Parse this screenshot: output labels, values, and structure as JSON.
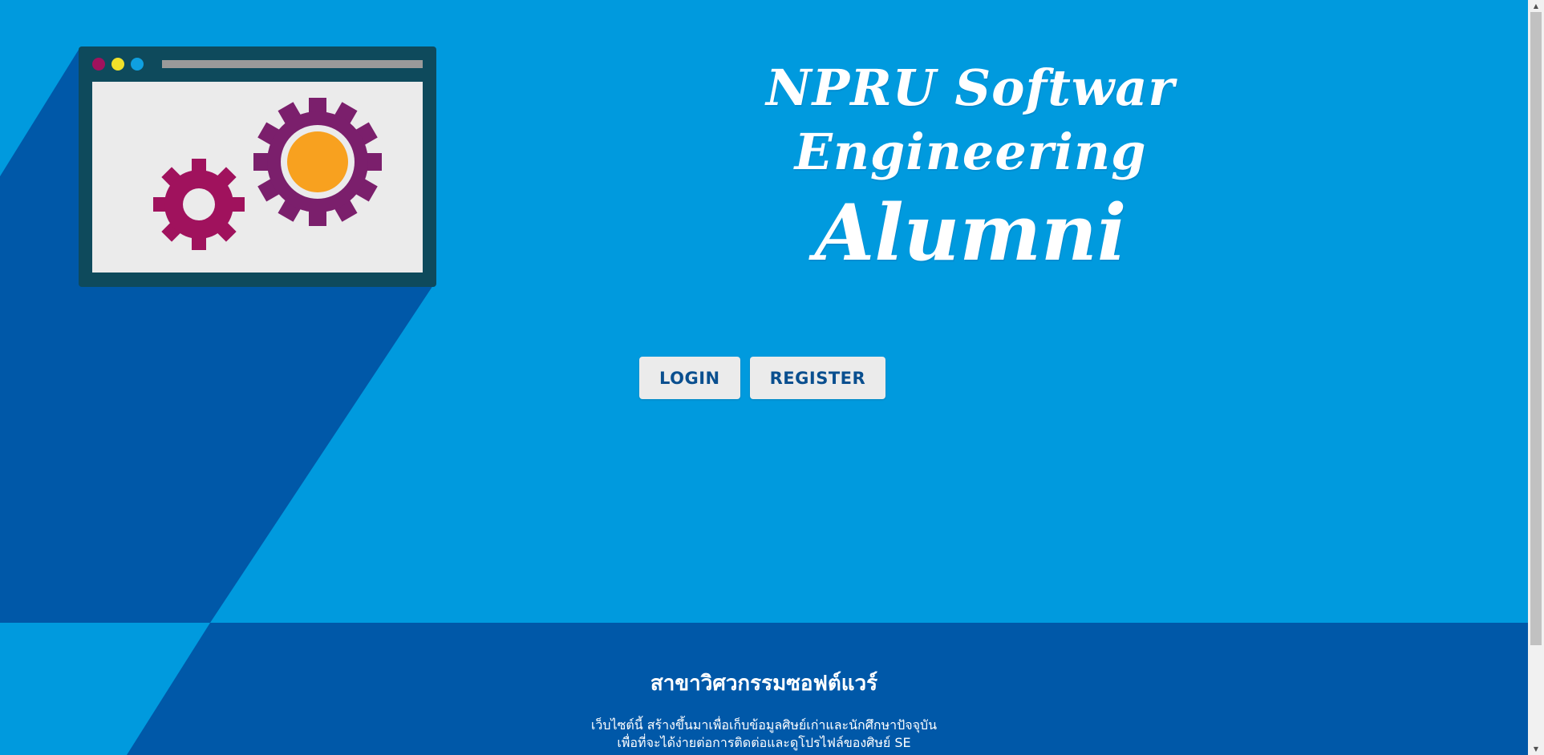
{
  "hero": {
    "title_line1": "NPRU Softwar Engineering",
    "title_line2": "Alumni"
  },
  "auth": {
    "login_label": "LOGIN",
    "register_label": "REGISTER"
  },
  "footer": {
    "heading": "สาขาวิศวกรรมซอฟต์แวร์",
    "description_line1": "เว็บไซต์นี้ สร้างขึ้นมาเพื่อเก็บข้อมูลศิษย์เก่าและนักศึกษาปัจจุบัน",
    "description_line2": "เพื่อที่จะได้ง่ายต่อการติดต่อและดูโปรไฟล์ของศิษย์ SE"
  },
  "colors": {
    "background": "#009ade",
    "shadow_blue": "#0058a8",
    "button_bg": "#ebebeb",
    "button_text": "#0a4f8f",
    "window_frame": "#0e4a5c",
    "gear_magenta": "#a0125d",
    "gear_purple": "#7b1f6c",
    "gear_center": "#f8a11f"
  },
  "icons": {
    "illustration": "browser-window-gears-icon",
    "scroll_up": "scroll-up-arrow-icon",
    "scroll_down": "scroll-down-arrow-icon"
  }
}
